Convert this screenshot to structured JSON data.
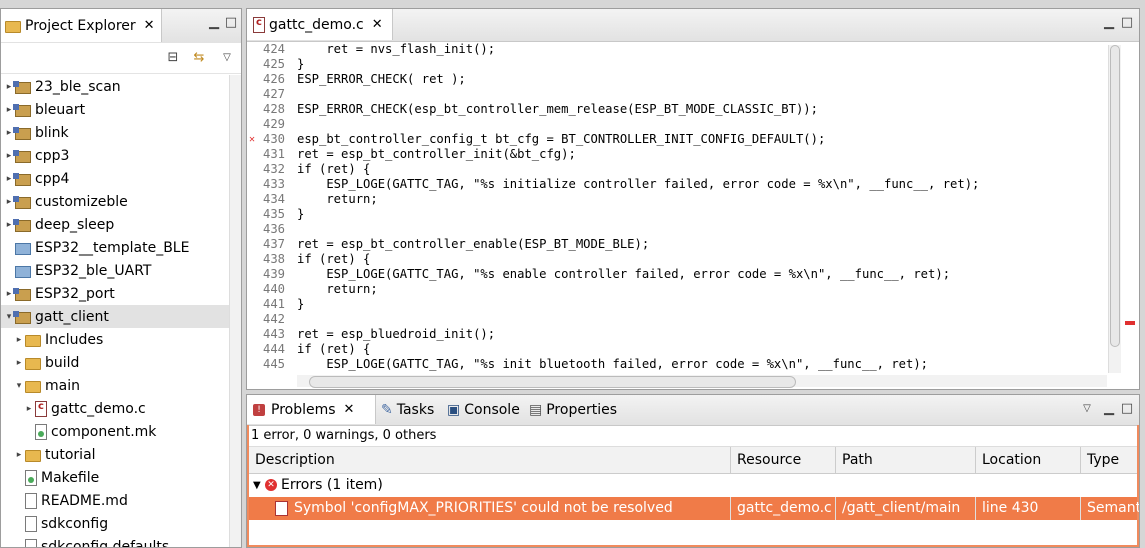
{
  "explorer": {
    "title": "Project Explorer",
    "items": [
      {
        "label": "23_ble_scan",
        "twisty": "▸",
        "icon": "project"
      },
      {
        "label": "bleuart",
        "twisty": "▸",
        "icon": "project"
      },
      {
        "label": "blink",
        "twisty": "▸",
        "icon": "project"
      },
      {
        "label": "cpp3",
        "twisty": "▸",
        "icon": "project"
      },
      {
        "label": "cpp4",
        "twisty": "▸",
        "icon": "project"
      },
      {
        "label": "customizeble",
        "twisty": "▸",
        "icon": "project"
      },
      {
        "label": "deep_sleep",
        "twisty": "▸",
        "icon": "project"
      },
      {
        "label": "ESP32__template_BLE",
        "twisty": "",
        "icon": "blue-folder"
      },
      {
        "label": "ESP32_ble_UART",
        "twisty": "",
        "icon": "blue-folder"
      },
      {
        "label": "ESP32_port",
        "twisty": "▸",
        "icon": "project"
      },
      {
        "label": "gatt_client",
        "twisty": "▾",
        "icon": "project-error",
        "selected": true
      },
      {
        "label": "Includes",
        "twisty": "▸",
        "icon": "includes",
        "indent": 1
      },
      {
        "label": "build",
        "twisty": "▸",
        "icon": "folder",
        "indent": 1
      },
      {
        "label": "main",
        "twisty": "▾",
        "icon": "folder",
        "indent": 1
      },
      {
        "label": "gattc_demo.c",
        "twisty": "▸",
        "icon": "c-file",
        "indent": 2
      },
      {
        "label": "component.mk",
        "twisty": "",
        "icon": "mk-file",
        "indent": 2
      },
      {
        "label": "tutorial",
        "twisty": "▸",
        "icon": "folder",
        "indent": 1
      },
      {
        "label": "Makefile",
        "twisty": "",
        "icon": "mk-file",
        "indent": 1
      },
      {
        "label": "README.md",
        "twisty": "",
        "icon": "file",
        "indent": 1
      },
      {
        "label": "sdkconfig",
        "twisty": "",
        "icon": "file",
        "indent": 1
      },
      {
        "label": "sdkconfig.defaults",
        "twisty": "",
        "icon": "file",
        "indent": 1
      }
    ]
  },
  "editor": {
    "tab": "gattc_demo.c",
    "lines": [
      {
        "n": "424",
        "t": "    ret = nvs_flash_init();"
      },
      {
        "n": "425",
        "t": "}"
      },
      {
        "n": "426",
        "t": "ESP_ERROR_CHECK( ret );"
      },
      {
        "n": "427",
        "t": ""
      },
      {
        "n": "428",
        "t": "ESP_ERROR_CHECK(esp_bt_controller_mem_release(ESP_BT_MODE_CLASSIC_BT));"
      },
      {
        "n": "429",
        "t": ""
      },
      {
        "n": "430",
        "t": "esp_bt_controller_config_t bt_cfg = BT_CONTROLLER_INIT_CONFIG_DEFAULT();"
      },
      {
        "n": "431",
        "t": "ret = esp_bt_controller_init(&bt_cfg);"
      },
      {
        "n": "432",
        "t": "if (ret) {"
      },
      {
        "n": "433",
        "t": "    ESP_LOGE(GATTC_TAG, \"%s initialize controller failed, error code = %x\\n\", __func__, ret);"
      },
      {
        "n": "434",
        "t": "    return;"
      },
      {
        "n": "435",
        "t": "}"
      },
      {
        "n": "436",
        "t": ""
      },
      {
        "n": "437",
        "t": "ret = esp_bt_controller_enable(ESP_BT_MODE_BLE);"
      },
      {
        "n": "438",
        "t": "if (ret) {"
      },
      {
        "n": "439",
        "t": "    ESP_LOGE(GATTC_TAG, \"%s enable controller failed, error code = %x\\n\", __func__, ret);"
      },
      {
        "n": "440",
        "t": "    return;"
      },
      {
        "n": "441",
        "t": "}"
      },
      {
        "n": "442",
        "t": ""
      },
      {
        "n": "443",
        "t": "ret = esp_bluedroid_init();"
      },
      {
        "n": "444",
        "t": "if (ret) {"
      },
      {
        "n": "445",
        "t": "    ESP_LOGE(GATTC_TAG, \"%s init bluetooth failed, error code = %x\\n\", __func__, ret);"
      }
    ]
  },
  "problems": {
    "tabs": [
      "Problems",
      "Tasks",
      "Console",
      "Properties"
    ],
    "summary": "1 error, 0 warnings, 0 others",
    "columns": [
      "Description",
      "Resource",
      "Path",
      "Location",
      "Type"
    ],
    "group": "Errors (1 item)",
    "row": {
      "description": "Symbol 'configMAX_PRIORITIES' could not be resolved",
      "resource": "gattc_demo.c",
      "path": "/gatt_client/main",
      "location": "line 430",
      "type": "Semantic"
    }
  },
  "colors": {
    "selection": "#f07b48",
    "error": "#e03030"
  }
}
